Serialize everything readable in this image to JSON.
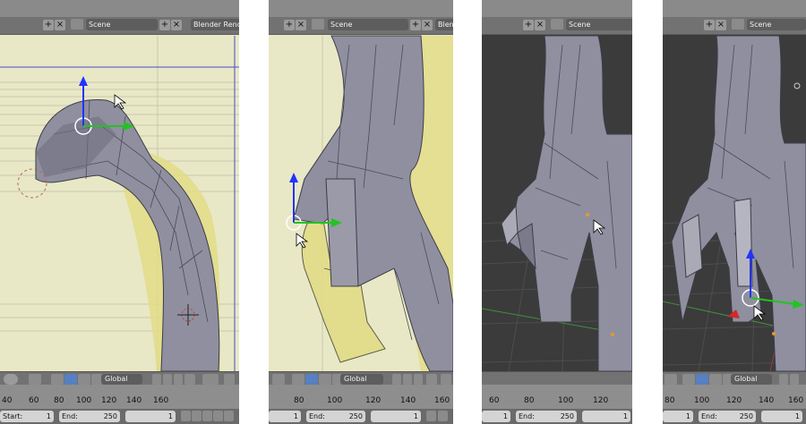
{
  "header": {
    "scene": "Scene",
    "renderer": "Blender Render",
    "add_symbol": "+",
    "close_symbol": "×"
  },
  "toolbar": {
    "orientation": "Global"
  },
  "timeline": {
    "start_label": "Start:",
    "start_value": "1",
    "end_label": "End:",
    "end_value": "250",
    "current_frame": "1"
  },
  "panels": [
    {
      "ruler": [
        "40",
        "60",
        "80",
        "100",
        "120",
        "140",
        "160"
      ]
    },
    {
      "ruler": [
        "80",
        "100",
        "120",
        "140",
        "160"
      ]
    },
    {
      "ruler": [
        "60",
        "80",
        "100",
        "120"
      ]
    },
    {
      "ruler": [
        "80",
        "100",
        "120",
        "140",
        "160"
      ]
    }
  ],
  "colors": {
    "viewport_yellow": "#e8e8c6",
    "viewport_dark": "#3b3b3b",
    "mesh_gray": "#8f8fa0",
    "header_gray": "#727272",
    "accent_blue": "#5680c2"
  }
}
